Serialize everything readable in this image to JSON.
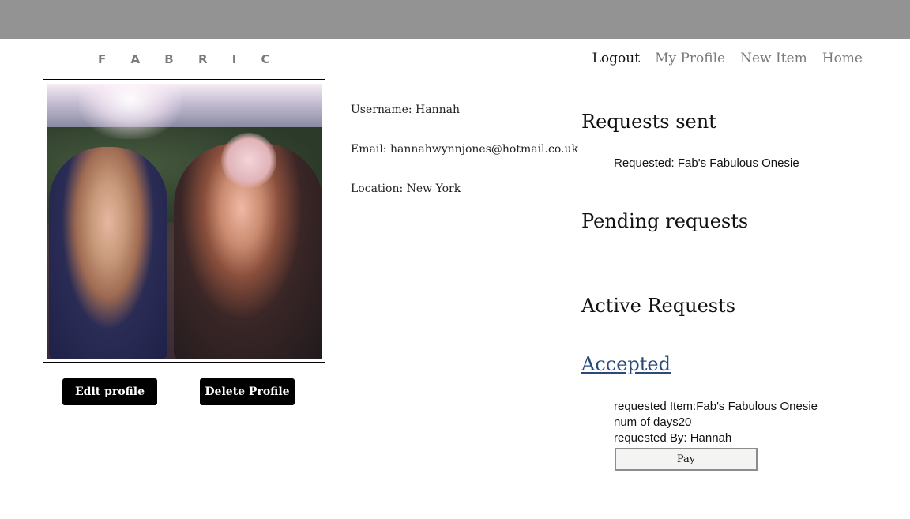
{
  "header": {
    "logo": "F A B R I C",
    "nav": {
      "logout": "Logout",
      "my_profile": "My Profile",
      "new_item": "New Item",
      "home": "Home"
    }
  },
  "profile": {
    "photo_alt": "Profile photo",
    "edit_label": "Edit profile",
    "delete_label": "Delete Profile",
    "username": "Username: Hannah",
    "email": "Email: hannahwynnjones@hotmail.co.uk",
    "location": "Location: New York"
  },
  "requests": {
    "sent_heading": "Requests sent",
    "sent_items": [
      "Requested: Fab's Fabulous Onesie"
    ],
    "pending_heading": "Pending requests",
    "active_heading": "Active Requests",
    "accepted_link": "Accepted",
    "accepted": {
      "item": "requested Item:Fab's Fabulous Onesie",
      "days": "num of days20",
      "by": "requested By: Hannah",
      "pay_label": "Pay"
    }
  },
  "colors": {
    "topbar": "#939393",
    "nav_text": "#7a7a7a",
    "accepted_link": "#2a4a7a",
    "button_bg": "#000000"
  }
}
